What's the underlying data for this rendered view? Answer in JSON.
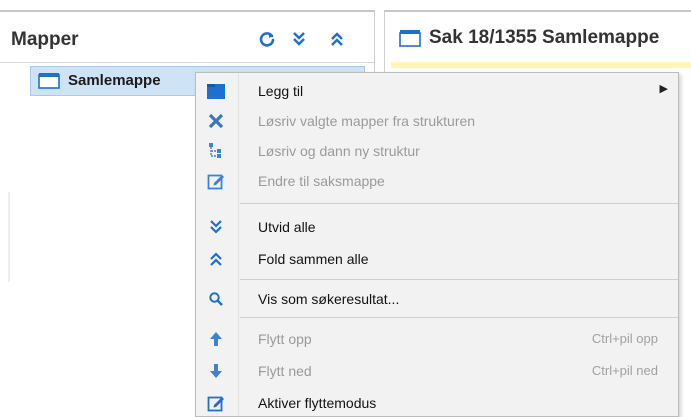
{
  "left_panel": {
    "title": "Mapper",
    "tree": {
      "selected_folder": "Samlemappe"
    },
    "header_icons": [
      "refresh-icon",
      "expand-all-icon",
      "collapse-all-icon"
    ]
  },
  "right_panel": {
    "title": "Sak 18/1355 Samlemappe"
  },
  "context_menu": {
    "items": [
      {
        "label": "Legg til",
        "icon": "folder-icon",
        "enabled": true,
        "submenu": true
      },
      {
        "label": "Løsriv valgte mapper fra strukturen",
        "icon": "close-icon",
        "enabled": false
      },
      {
        "label": "Løsriv og dann ny struktur",
        "icon": "hierarchy-icon",
        "enabled": false
      },
      {
        "label": "Endre til saksmappe",
        "icon": "edit-icon",
        "enabled": false
      },
      {
        "label": "Utvid alle",
        "icon": "expand-all-icon",
        "enabled": true
      },
      {
        "label": "Fold sammen alle",
        "icon": "collapse-all-icon",
        "enabled": true
      },
      {
        "label": "Vis som søkeresultat...",
        "icon": "search-icon",
        "enabled": true
      },
      {
        "label": "Flytt opp",
        "icon": "arrow-up-icon",
        "enabled": false,
        "shortcut": "Ctrl+pil opp"
      },
      {
        "label": "Flytt ned",
        "icon": "arrow-down-icon",
        "enabled": false,
        "shortcut": "Ctrl+pil ned"
      },
      {
        "label": "Aktiver flyttemodus",
        "icon": "edit-icon",
        "enabled": true
      }
    ]
  },
  "colors": {
    "accent": "#1f6fd1",
    "selection": "#cfe3f7",
    "disabled_text": "#9a9a9a",
    "menu_background": "#f2f2f2"
  }
}
